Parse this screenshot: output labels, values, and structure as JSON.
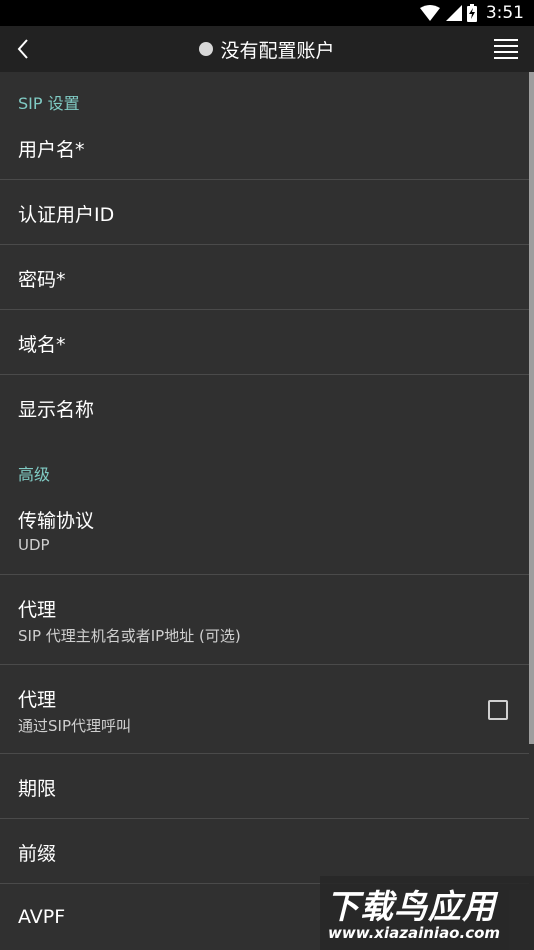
{
  "status_bar": {
    "time": "3:51",
    "icons": [
      "wifi-icon",
      "cellular-signal-icon",
      "battery-charging-icon"
    ]
  },
  "toolbar": {
    "back_icon": "chevron-left-icon",
    "title": "没有配置账户",
    "status_dot_color": "#d8d8d8",
    "menu_icon": "hamburger-menu-icon"
  },
  "sections": {
    "sip": {
      "header": "SIP 设置",
      "items": [
        {
          "label": "用户名*"
        },
        {
          "label": "认证用户ID"
        },
        {
          "label": "密码*"
        },
        {
          "label": "域名*"
        },
        {
          "label": "显示名称"
        }
      ]
    },
    "advanced": {
      "header": "高级",
      "items": [
        {
          "label": "传输协议",
          "sub": "UDP"
        },
        {
          "label": "代理",
          "sub": "SIP 代理主机名或者IP地址 (可选)"
        },
        {
          "label": "代理",
          "sub": "通过SIP代理呼叫",
          "checked": false
        },
        {
          "label": "期限"
        },
        {
          "label": "前缀"
        },
        {
          "label": "AVPF"
        }
      ]
    }
  },
  "watermark": {
    "main": "下载鸟应用",
    "url": "www.xiazainiao.com"
  },
  "colors": {
    "accent": "#80cbc4",
    "background": "#303030",
    "toolbar": "#222222",
    "divider": "#4a4a4a"
  }
}
